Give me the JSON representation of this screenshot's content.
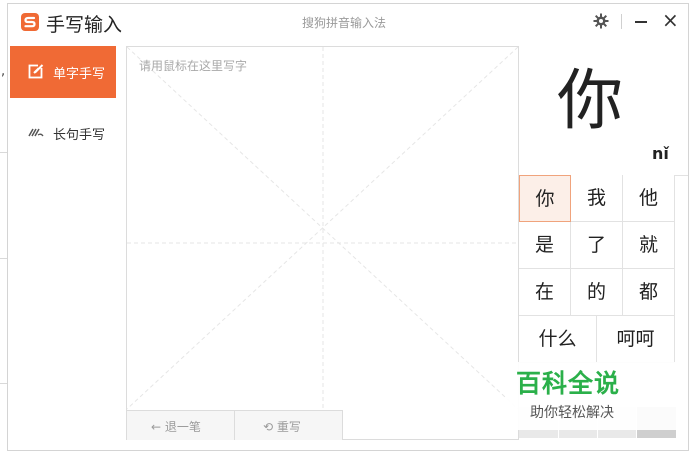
{
  "titlebar": {
    "app_title": "手写输入",
    "subtitle": "搜狗拼音输入法"
  },
  "nav": {
    "items": [
      {
        "label": "单字手写",
        "icon": "edit-icon",
        "active": true
      },
      {
        "label": "长句手写",
        "icon": "scribble-icon",
        "active": false
      }
    ]
  },
  "pad": {
    "placeholder": "请用鼠标在这里写字",
    "undo_label": "退一笔",
    "rewrite_label": "重写"
  },
  "preview": {
    "char": "你",
    "pinyin": "nǐ"
  },
  "candidates": {
    "row1": [
      "你",
      "我",
      "他"
    ],
    "row2": [
      "是",
      "了",
      "就"
    ],
    "row3": [
      "在",
      "的",
      "都"
    ],
    "row4": [
      "什么",
      "呵呵"
    ]
  },
  "watermark": {
    "title": "百科全说",
    "subtitle": "助你轻松解决"
  },
  "colors": {
    "accent": "#f06a35",
    "watermark_green": "#2bb04a"
  }
}
